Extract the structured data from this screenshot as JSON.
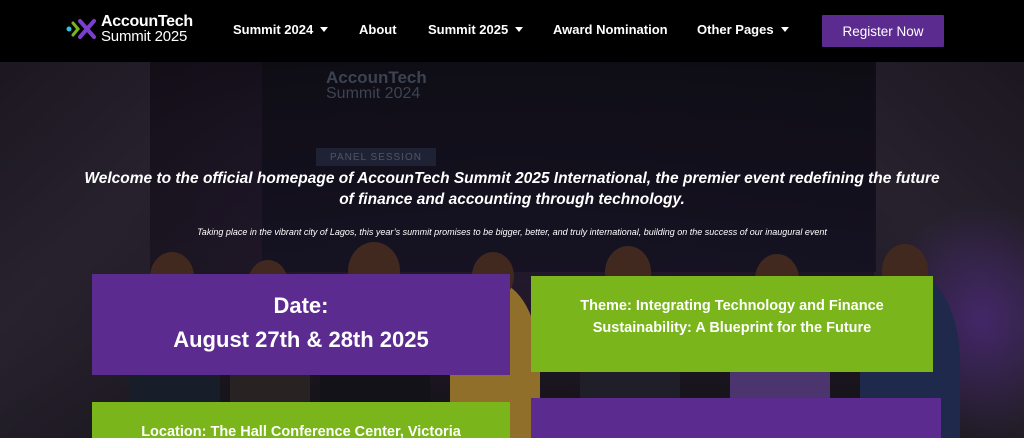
{
  "brand": {
    "line1": "AccounTech",
    "line2": "Summit 2025",
    "colors": {
      "purple": "#5b2b8f",
      "green": "#79b51b",
      "cyan": "#2ec4d6"
    }
  },
  "nav": {
    "items": [
      {
        "label": "Summit 2024",
        "dropdown": true
      },
      {
        "label": "About",
        "dropdown": false
      },
      {
        "label": "Summit 2025",
        "dropdown": true
      },
      {
        "label": "Award Nomination",
        "dropdown": false
      },
      {
        "label": "Other Pages",
        "dropdown": true
      }
    ],
    "register_label": "Register Now",
    "dropdown_icon": "caret-down-icon"
  },
  "hero": {
    "background_logo_line1": "AccounTech",
    "background_logo_line2": "Summit 2024",
    "background_panel": "PANEL SESSION",
    "headline": "Welcome to the official homepage of AccounTech Summit 2025 International, the premier event redefining the future of finance and accounting through technology.",
    "subline": "Taking place in the vibrant city of Lagos, this year’s summit promises to be bigger, better, and truly international, building on the success of our inaugural event"
  },
  "cards": {
    "date_label": "Date:",
    "date_value": "August 27th & 28th 2025",
    "theme": "Theme: Integrating Technology and Finance Sustainability: A Blueprint for the Future",
    "location": "Location: The Hall Conference Center, Victoria"
  }
}
